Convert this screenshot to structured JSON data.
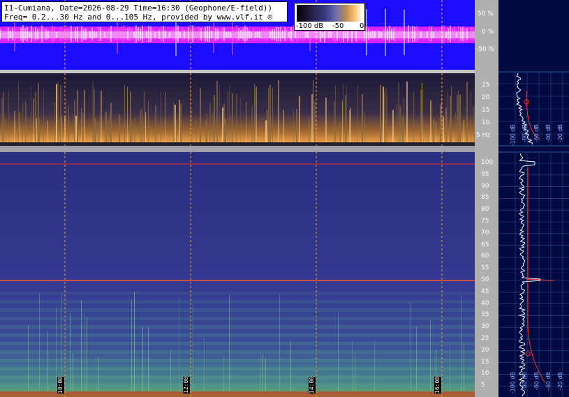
{
  "header": {
    "line1": "I1-Cumiana, Date=2026-08-29 Time=16:30 (Geophone/E-field))",
    "line2": "Freq= 0.2...30 Hz and 0...105 Hz, provided by www.vlf.it ©"
  },
  "color_scale": {
    "labels": [
      "-100 dB",
      "-50",
      "0"
    ]
  },
  "waveform_axis": [
    "50 %",
    "0 %",
    "-50 %"
  ],
  "upper_freq_axis": [
    "25",
    "20",
    "15",
    "10",
    "5 Hz"
  ],
  "lower_freq_axis": [
    "100",
    "95",
    "90",
    "85",
    "80",
    "75",
    "70",
    "65",
    "60",
    "55",
    "50",
    "45",
    "40",
    "35",
    "30",
    "25",
    "20",
    "15",
    "10",
    "5"
  ],
  "time_labels": [
    "10:00",
    "12:00",
    "14:00",
    "16:00"
  ],
  "upper_side_labels": [
    "-100 dB",
    "-80 dB",
    "-60 dB",
    "-40 dB",
    "-20 dB"
  ],
  "lower_side_labels": [
    "-100 dB",
    "-80 dB",
    "-60 dB",
    "-40 dB",
    "-20 dB"
  ],
  "colors": {
    "waveform_bg": "#1a0cff",
    "waveform_trace": "#ff28ff",
    "marker_line": "#ff2020",
    "side_bg": "#000a40"
  }
}
